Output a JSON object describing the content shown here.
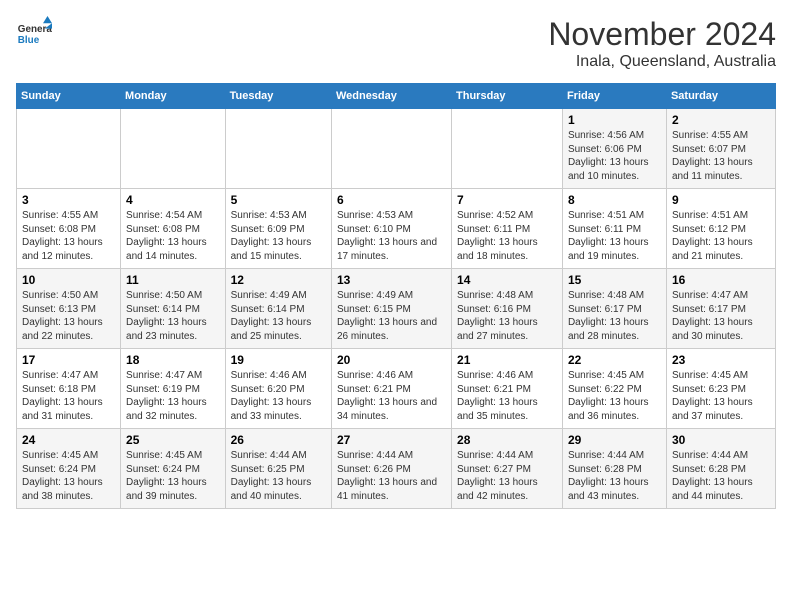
{
  "header": {
    "logo_line1": "General",
    "logo_line2": "Blue",
    "title": "November 2024",
    "subtitle": "Inala, Queensland, Australia"
  },
  "columns": [
    "Sunday",
    "Monday",
    "Tuesday",
    "Wednesday",
    "Thursday",
    "Friday",
    "Saturday"
  ],
  "weeks": [
    [
      {
        "day": "",
        "info": ""
      },
      {
        "day": "",
        "info": ""
      },
      {
        "day": "",
        "info": ""
      },
      {
        "day": "",
        "info": ""
      },
      {
        "day": "",
        "info": ""
      },
      {
        "day": "1",
        "info": "Sunrise: 4:56 AM\nSunset: 6:06 PM\nDaylight: 13 hours and 10 minutes."
      },
      {
        "day": "2",
        "info": "Sunrise: 4:55 AM\nSunset: 6:07 PM\nDaylight: 13 hours and 11 minutes."
      }
    ],
    [
      {
        "day": "3",
        "info": "Sunrise: 4:55 AM\nSunset: 6:08 PM\nDaylight: 13 hours and 12 minutes."
      },
      {
        "day": "4",
        "info": "Sunrise: 4:54 AM\nSunset: 6:08 PM\nDaylight: 13 hours and 14 minutes."
      },
      {
        "day": "5",
        "info": "Sunrise: 4:53 AM\nSunset: 6:09 PM\nDaylight: 13 hours and 15 minutes."
      },
      {
        "day": "6",
        "info": "Sunrise: 4:53 AM\nSunset: 6:10 PM\nDaylight: 13 hours and 17 minutes."
      },
      {
        "day": "7",
        "info": "Sunrise: 4:52 AM\nSunset: 6:11 PM\nDaylight: 13 hours and 18 minutes."
      },
      {
        "day": "8",
        "info": "Sunrise: 4:51 AM\nSunset: 6:11 PM\nDaylight: 13 hours and 19 minutes."
      },
      {
        "day": "9",
        "info": "Sunrise: 4:51 AM\nSunset: 6:12 PM\nDaylight: 13 hours and 21 minutes."
      }
    ],
    [
      {
        "day": "10",
        "info": "Sunrise: 4:50 AM\nSunset: 6:13 PM\nDaylight: 13 hours and 22 minutes."
      },
      {
        "day": "11",
        "info": "Sunrise: 4:50 AM\nSunset: 6:14 PM\nDaylight: 13 hours and 23 minutes."
      },
      {
        "day": "12",
        "info": "Sunrise: 4:49 AM\nSunset: 6:14 PM\nDaylight: 13 hours and 25 minutes."
      },
      {
        "day": "13",
        "info": "Sunrise: 4:49 AM\nSunset: 6:15 PM\nDaylight: 13 hours and 26 minutes."
      },
      {
        "day": "14",
        "info": "Sunrise: 4:48 AM\nSunset: 6:16 PM\nDaylight: 13 hours and 27 minutes."
      },
      {
        "day": "15",
        "info": "Sunrise: 4:48 AM\nSunset: 6:17 PM\nDaylight: 13 hours and 28 minutes."
      },
      {
        "day": "16",
        "info": "Sunrise: 4:47 AM\nSunset: 6:17 PM\nDaylight: 13 hours and 30 minutes."
      }
    ],
    [
      {
        "day": "17",
        "info": "Sunrise: 4:47 AM\nSunset: 6:18 PM\nDaylight: 13 hours and 31 minutes."
      },
      {
        "day": "18",
        "info": "Sunrise: 4:47 AM\nSunset: 6:19 PM\nDaylight: 13 hours and 32 minutes."
      },
      {
        "day": "19",
        "info": "Sunrise: 4:46 AM\nSunset: 6:20 PM\nDaylight: 13 hours and 33 minutes."
      },
      {
        "day": "20",
        "info": "Sunrise: 4:46 AM\nSunset: 6:21 PM\nDaylight: 13 hours and 34 minutes."
      },
      {
        "day": "21",
        "info": "Sunrise: 4:46 AM\nSunset: 6:21 PM\nDaylight: 13 hours and 35 minutes."
      },
      {
        "day": "22",
        "info": "Sunrise: 4:45 AM\nSunset: 6:22 PM\nDaylight: 13 hours and 36 minutes."
      },
      {
        "day": "23",
        "info": "Sunrise: 4:45 AM\nSunset: 6:23 PM\nDaylight: 13 hours and 37 minutes."
      }
    ],
    [
      {
        "day": "24",
        "info": "Sunrise: 4:45 AM\nSunset: 6:24 PM\nDaylight: 13 hours and 38 minutes."
      },
      {
        "day": "25",
        "info": "Sunrise: 4:45 AM\nSunset: 6:24 PM\nDaylight: 13 hours and 39 minutes."
      },
      {
        "day": "26",
        "info": "Sunrise: 4:44 AM\nSunset: 6:25 PM\nDaylight: 13 hours and 40 minutes."
      },
      {
        "day": "27",
        "info": "Sunrise: 4:44 AM\nSunset: 6:26 PM\nDaylight: 13 hours and 41 minutes."
      },
      {
        "day": "28",
        "info": "Sunrise: 4:44 AM\nSunset: 6:27 PM\nDaylight: 13 hours and 42 minutes."
      },
      {
        "day": "29",
        "info": "Sunrise: 4:44 AM\nSunset: 6:28 PM\nDaylight: 13 hours and 43 minutes."
      },
      {
        "day": "30",
        "info": "Sunrise: 4:44 AM\nSunset: 6:28 PM\nDaylight: 13 hours and 44 minutes."
      }
    ]
  ]
}
